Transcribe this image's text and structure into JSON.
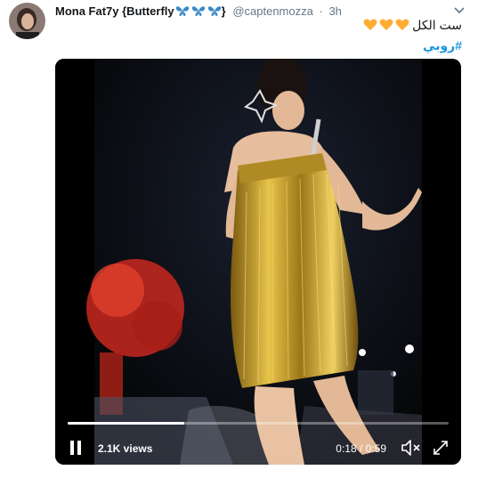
{
  "tweet": {
    "author_name": "Mona Fat7y {Butterfly",
    "author_name_suffix": "}",
    "handle": "@captenmozza",
    "separator": "·",
    "time": "3h",
    "text_line1": "ست الكل",
    "hashtag": "#روبي"
  },
  "video": {
    "views": "2.1K views",
    "time_readout": "0:18 / 0:59",
    "progress_fraction": 0.305,
    "icons": [
      "pause-icon",
      "volume-muted-icon",
      "fullscreen-icon"
    ]
  },
  "colors": {
    "link": "#1b95e0",
    "secondary_text": "#657786",
    "heart": "#ffac33",
    "butterfly": "#3b88c3"
  }
}
